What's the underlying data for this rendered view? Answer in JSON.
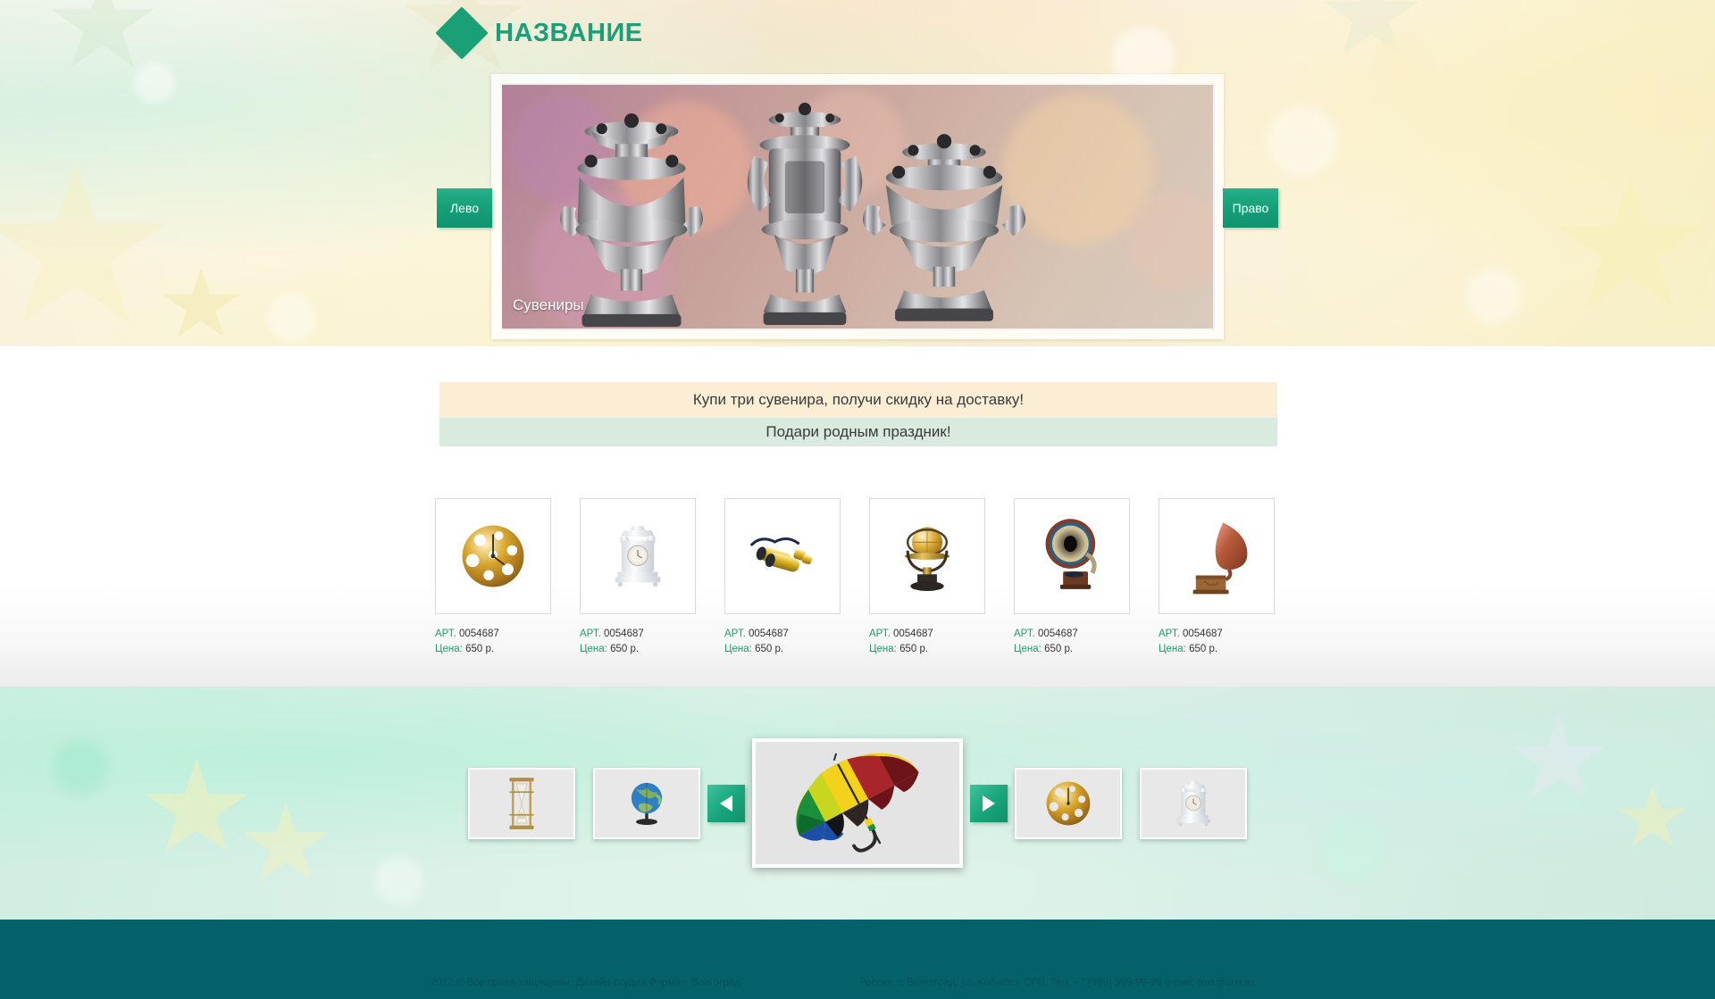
{
  "header": {
    "logo_icon": "diamond-icon",
    "logo_text": "НАЗВАНИЕ"
  },
  "hero": {
    "caption": "Сувениры",
    "prev_label": "Лево",
    "next_label": "Право",
    "image_subject": "silver samovars on bokeh background"
  },
  "promos": [
    {
      "text": "Купи три сувенира, получи скидку на доставку!",
      "bg": "#fbeed5"
    },
    {
      "text": "Подари родным праздник!",
      "bg": "#d9ebdf"
    }
  ],
  "products": {
    "art_label": "АРТ.",
    "price_label": "Цена:",
    "items": [
      {
        "art": "0054687",
        "price": "650 р.",
        "image": "gold-disc-clock"
      },
      {
        "art": "0054687",
        "price": "650 р.",
        "image": "white-mantel-clock"
      },
      {
        "art": "0054687",
        "price": "650 р.",
        "image": "brass-binoculars"
      },
      {
        "art": "0054687",
        "price": "650 р.",
        "image": "gold-globe-trophy"
      },
      {
        "art": "0054687",
        "price": "650 р.",
        "image": "gramophone-front"
      },
      {
        "art": "0054687",
        "price": "650 р.",
        "image": "gramophone-side"
      }
    ]
  },
  "carousel": {
    "prev_icon": "triangle-left-icon",
    "next_icon": "triangle-right-icon",
    "thumbs_left": [
      {
        "image": "hourglass"
      },
      {
        "image": "globe"
      }
    ],
    "main": {
      "image": "rainbow-umbrella"
    },
    "thumbs_right": [
      {
        "image": "gold-disc-clock"
      },
      {
        "image": "white-mantel-clock"
      }
    ]
  },
  "footer": {
    "copyright": "2012 © Все права защищены. Дизайн-студия Фирма г. Волгоград.",
    "contacts": "Россия, г. Волгоград, ул. Кой-кого, ОГО. Тел. +7 (999) 999-99-99 e-mail: text@text.ru"
  },
  "colors": {
    "brand_green": "#1e9e78",
    "footer_teal": "#04616a",
    "promo_cream": "#fbeed5",
    "promo_mint": "#d9ebdf"
  }
}
